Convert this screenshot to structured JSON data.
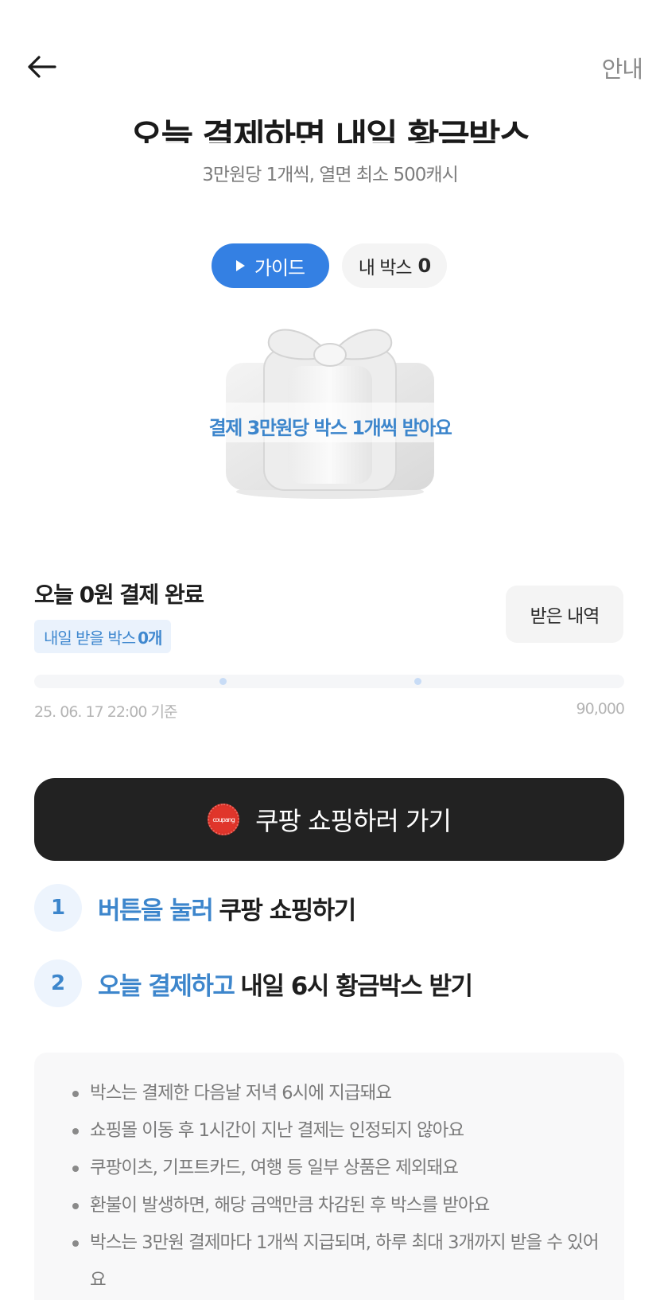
{
  "header": {
    "info_label": "안내"
  },
  "hero": {
    "title": "오늘 결제하면 내일 황금박스",
    "subtitle": "3만원당 1개씩, 열면 최소 500캐시",
    "guide_label": "가이드",
    "mybox_label": "내 박스",
    "mybox_count": "0",
    "gift_caption": "결제 3만원당 박스 1개씩 받아요"
  },
  "status": {
    "paid_title": "오늘 0원 결제 완료",
    "tomorrow_label": "내일 받을 박스",
    "tomorrow_count": "0개",
    "history_label": "받은 내역",
    "progress_value": 0,
    "progress_max_value": 90000,
    "progress_time": "25. 06. 17 22:00 기준",
    "progress_max": "90,000"
  },
  "cta": {
    "logo_text": "coupang",
    "label": "쿠팡 쇼핑하러 가기"
  },
  "steps": [
    {
      "num": "1",
      "highlight": "버튼을 눌러",
      "text": "쿠팡 쇼핑하기"
    },
    {
      "num": "2",
      "highlight": "오늘 결제하고",
      "text": "내일 6시 황금박스 받기"
    }
  ],
  "notices": [
    "박스는 결제한 다음날 저녁 6시에 지급돼요",
    "쇼핑몰 이동 후 1시간이 지난 결제는 인정되지 않아요",
    "쿠팡이츠, 기프트카드, 여행 등 일부 상품은 제외돼요",
    "환불이 발생하면, 해당 금액만큼 차감된 후 박스를 받아요",
    "박스는 3만원 결제마다 1개씩 지급되며, 하루 최대 3개까지 받을 수 있어요"
  ],
  "colors": {
    "accent": "#3480e3",
    "accent_text": "#3d86cc",
    "cta_bg": "#222222"
  }
}
